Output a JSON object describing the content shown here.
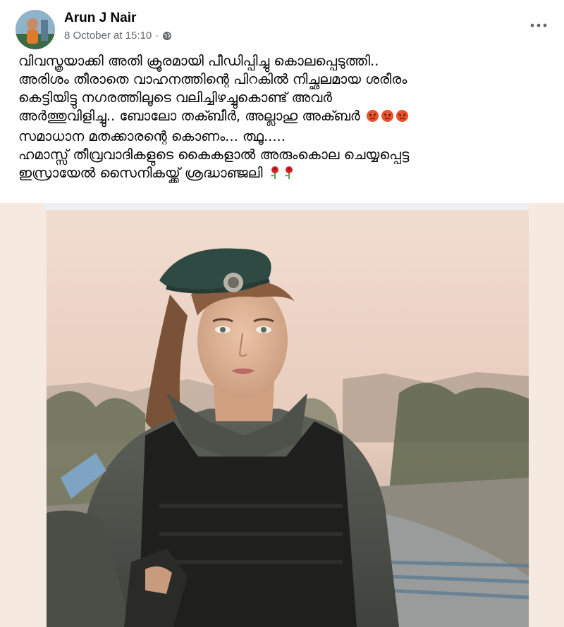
{
  "post": {
    "author": "Arun J Nair",
    "timestamp": "8 October at 15:10",
    "separator": "·",
    "privacy_icon": "globe-icon",
    "more_icon": "more-options-icon",
    "text_lines": [
      "വിവസ്ത്രയാക്കി അതി ക്രൂരമായി പീഡിപ്പിച്ചു കൊലപ്പെടുത്തി..",
      "അരിശം തീരാതെ വാഹനത്തിന്റെ പിറകിൽ നിച്ഛലമായ ശരീരം",
      "കെട്ടിയിട്ടു നഗരത്തിലൂടെ വലിച്ചിഴച്ചുകൊണ്ട് അവർ",
      "അർത്തുവിളിച്ചു.. ബോലോ തക്ബീർ, അല്ലാഹു അക്ബർ",
      "സമാധാന മതക്കാരന്റെ കൊണം... ത്ഥൂ.....",
      "ഹമാസ്സ് തീവ്രവാദികളുടെ കൈകളാൽ അരുംകൊല ചെയ്യപ്പെട്ട",
      "ഇസ്രായേൽ സൈനികയ്ക്ക് ശ്രദ്ധാഞ്ജലി"
    ],
    "emoji_angry": [
      "angry-face-icon",
      "angry-face-icon",
      "angry-face-icon"
    ],
    "emoji_rose": [
      "rose-icon",
      "rose-icon"
    ]
  },
  "colors": {
    "text": "#050505",
    "meta": "#65676b",
    "media_bg": "#f6e9df",
    "angry_face": "#e8542c",
    "rose": "#d8232a"
  }
}
